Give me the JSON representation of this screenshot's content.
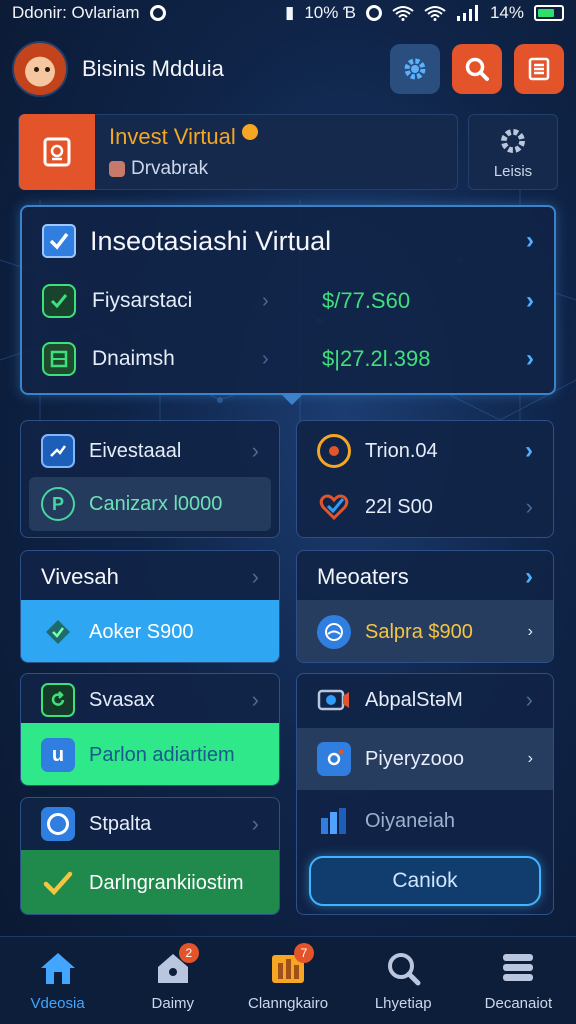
{
  "status_bar": {
    "left_text": "Ddonir: Ovlariam",
    "signal_text": "10% Ɓ",
    "battery_text": "14%"
  },
  "header": {
    "user_name": "Bisinis Mdduia"
  },
  "banner": {
    "title": "Invest Virtual",
    "subtitle": "Drvabrak",
    "settings_label": "Leisis"
  },
  "main_card": {
    "title": "Inseotasiashi Virtual",
    "items": [
      {
        "name": "Fiysarstaci",
        "amount": "$/77.S60"
      },
      {
        "name": "Dnaimsh",
        "amount": "$|27.2l.398"
      }
    ]
  },
  "cards": {
    "invest": {
      "row1": "Eivestaaal",
      "row2": "Canizarx l0000"
    },
    "trion": {
      "row1": "Trion.04",
      "row2": "22l S00"
    },
    "vivesah": {
      "title": "Vivesah",
      "pill": "Aoker S900"
    },
    "meoaters": {
      "title": "Meoaters",
      "pill": "Salpra $900"
    },
    "svasax": {
      "title": "Svasax",
      "pill": "Parlon adiartiem"
    },
    "apps": {
      "row1": "AbpalStəM",
      "row2": "Piyeryzooo",
      "row3": "Oiyaneiah"
    },
    "spalta": {
      "title": "Stpalta",
      "pill": "Darlngrankiiostim"
    },
    "cta": "Caniok"
  },
  "bottom_nav": [
    {
      "label": "Vdeosia",
      "badge": ""
    },
    {
      "label": "Daimy",
      "badge": "2"
    },
    {
      "label": "Clanngkairo",
      "badge": "7"
    },
    {
      "label": "Lhyetiap",
      "badge": ""
    },
    {
      "label": "Decanaiot",
      "badge": ""
    }
  ],
  "colors": {
    "accent_orange": "#e4542a",
    "accent_blue": "#2f9cf5",
    "accent_green": "#2ee88a",
    "amount_green": "#3ee07a",
    "dark_green": "#1f8a4c"
  }
}
